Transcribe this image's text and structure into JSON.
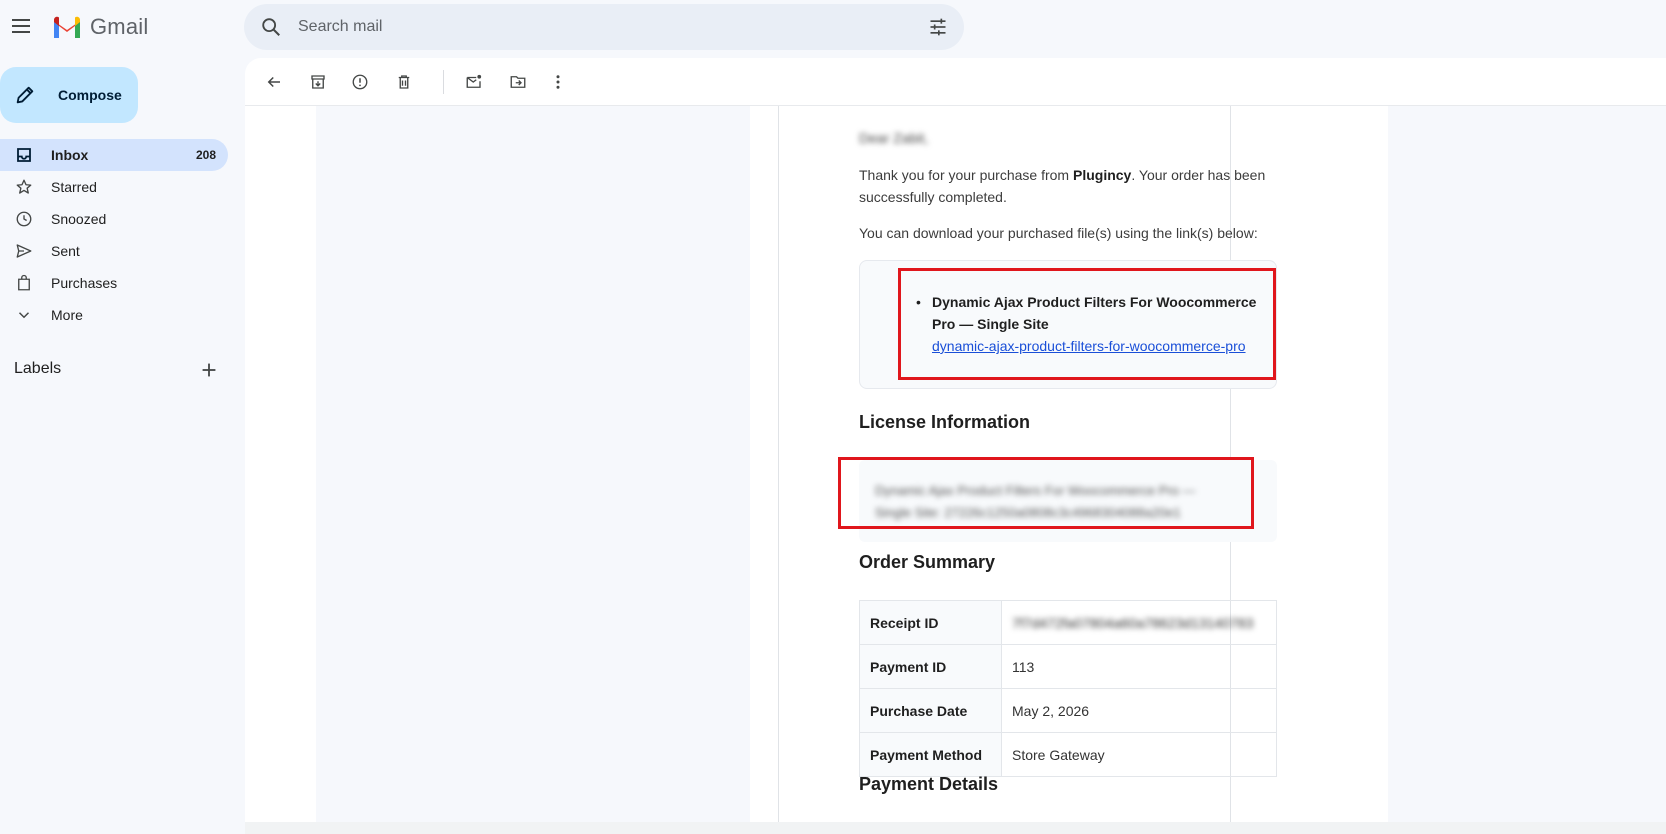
{
  "app": {
    "name": "Gmail"
  },
  "search": {
    "placeholder": "Search mail"
  },
  "compose": {
    "label": "Compose"
  },
  "nav": {
    "items": [
      {
        "label": "Inbox",
        "count": "208",
        "icon": "inbox-icon"
      },
      {
        "label": "Starred",
        "count": "",
        "icon": "star-icon"
      },
      {
        "label": "Snoozed",
        "count": "",
        "icon": "clock-icon"
      },
      {
        "label": "Sent",
        "count": "",
        "icon": "send-icon"
      },
      {
        "label": "Purchases",
        "count": "",
        "icon": "shopping-bag-icon"
      },
      {
        "label": "More",
        "count": "",
        "icon": "chevron-down-icon"
      }
    ]
  },
  "labels": {
    "title": "Labels"
  },
  "toolbar": {
    "icons": [
      "back-arrow-icon",
      "archive-icon",
      "report-spam-icon",
      "delete-icon",
      "mark-unread-icon",
      "move-to-icon",
      "more-vert-icon"
    ]
  },
  "email": {
    "greeting": "Dear Zabit,",
    "thanks_prefix": "Thank you for your purchase from ",
    "thanks_brand": "Plugincy",
    "thanks_suffix": ". Your order has been successfully completed.",
    "download_intro": "You can download your purchased file(s) using the link(s) below:",
    "download_item_name": "Dynamic Ajax Product Filters For Woocommerce Pro — Single Site",
    "download_item_link": "dynamic-ajax-product-filters-for-woocommerce-pro",
    "license_heading": "License Information",
    "license_text": "Dynamic Ajax Product Filters For Woocommerce Pro — Single Site: 27226c1250a0808c3c4968304088a20e1",
    "order_heading": "Order Summary",
    "order_rows": [
      {
        "key": "Receipt ID",
        "value": "7f7d472fa07804a60a78623d13140783",
        "blurred": true
      },
      {
        "key": "Payment ID",
        "value": "113",
        "blurred": false
      },
      {
        "key": "Purchase Date",
        "value": "May 2, 2026",
        "blurred": false
      },
      {
        "key": "Payment Method",
        "value": "Store Gateway",
        "blurred": false
      }
    ],
    "payment_heading": "Payment Details"
  },
  "colors": {
    "highlight_box": "#e0161c",
    "compose_bg": "#c2e7ff",
    "active_nav_bg": "#d3e3fd",
    "link": "#1a4fd8"
  }
}
